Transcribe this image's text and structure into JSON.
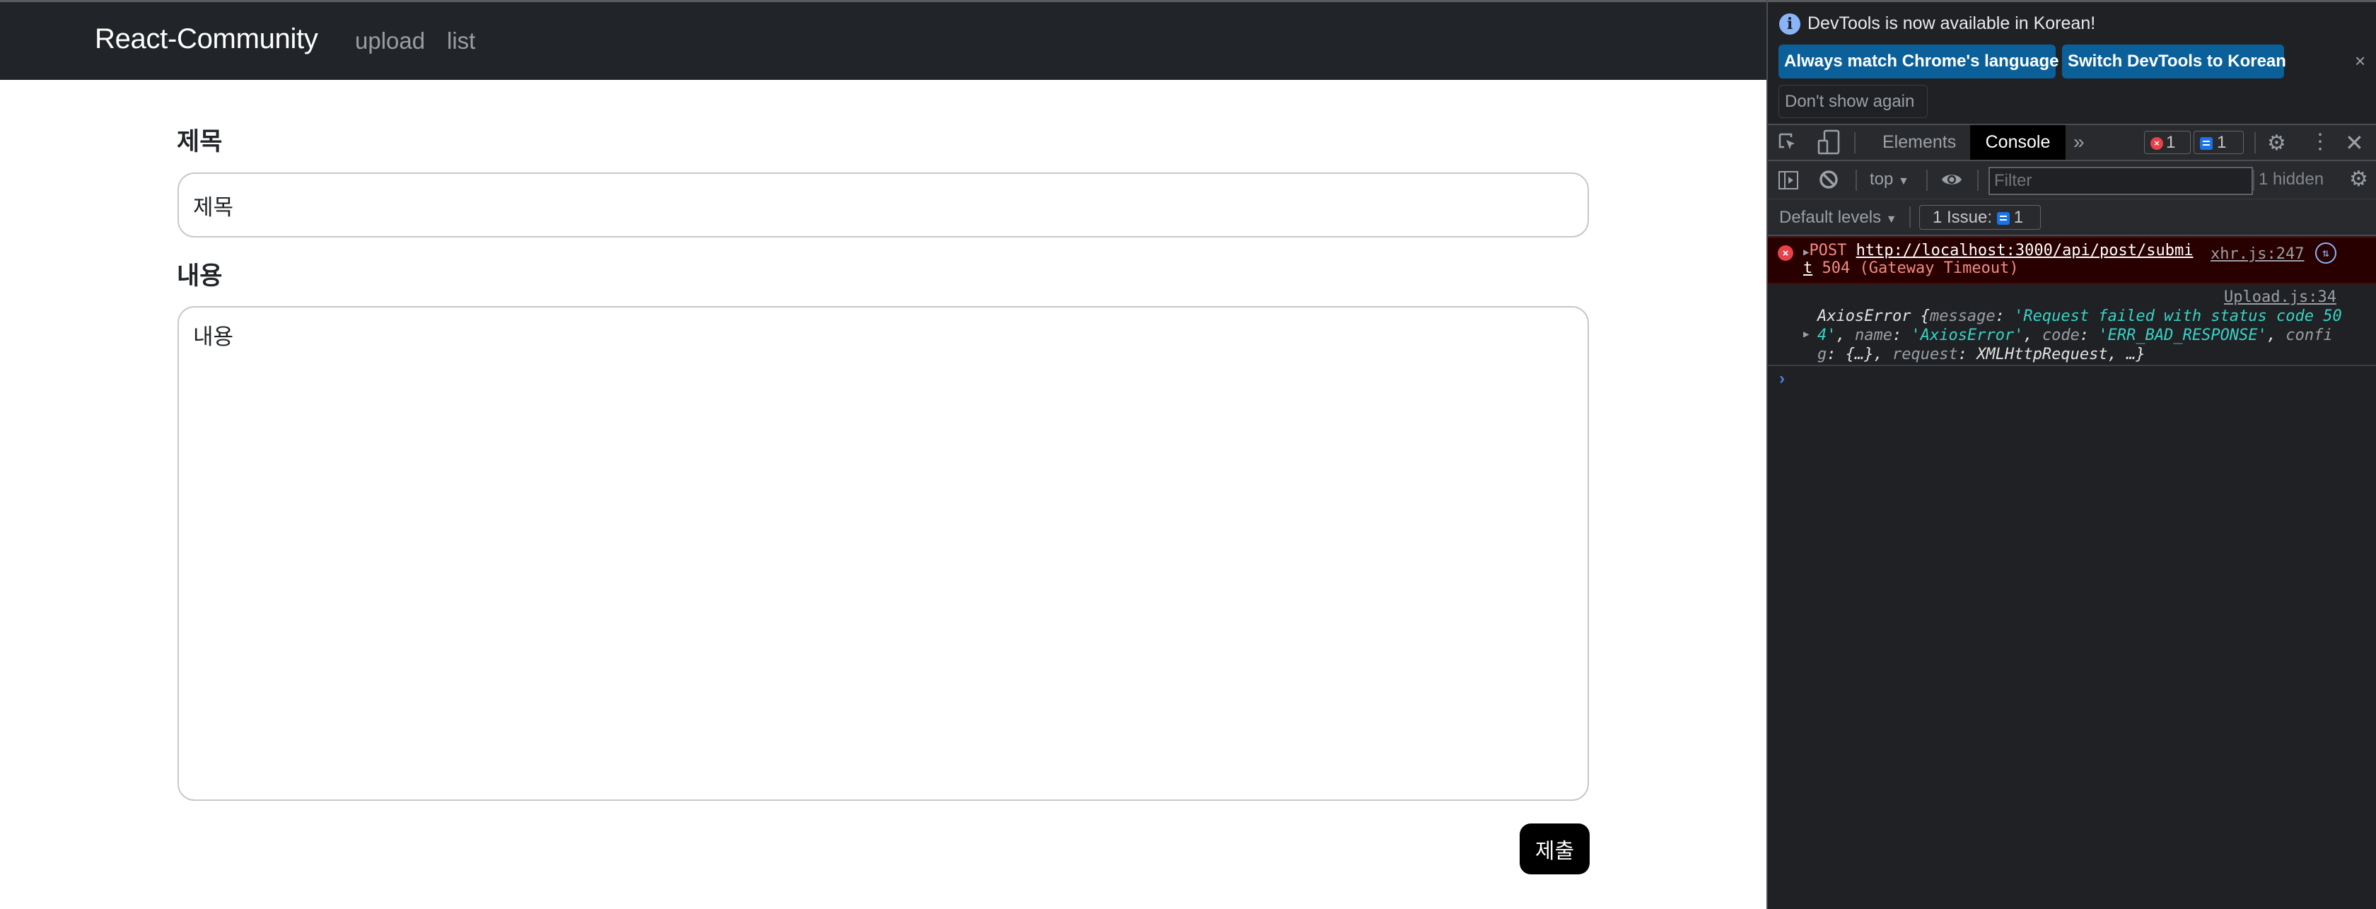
{
  "navbar": {
    "brand": "React-Community",
    "links": [
      "upload",
      "list"
    ]
  },
  "form": {
    "title_label": "제목",
    "title_value": "제목",
    "content_label": "내용",
    "content_value": "내용",
    "submit_label": "제출"
  },
  "devtools": {
    "banner": {
      "icon": "info-icon",
      "message": "DevTools is now available in Korean!",
      "primary_button": "Always match Chrome's language",
      "secondary_button": "Switch DevTools to Korean",
      "dismiss_button": "Don't show again",
      "close_glyph": "×"
    },
    "tabs": [
      {
        "label": "Elements",
        "active": false
      },
      {
        "label": "Console",
        "active": true
      }
    ],
    "more_tabs_glyph": "»",
    "error_count": "1",
    "message_count": "1",
    "toolbar": {
      "context": "top",
      "filter_placeholder": "Filter",
      "hidden_count": "1 hidden"
    },
    "levels": {
      "label": "Default levels",
      "issues_label": "1 Issue:",
      "issues_count": "1"
    },
    "console": {
      "error": {
        "method": "POST",
        "url_part1": "http://localhost:3000/api/post/submi",
        "url_part2": "t",
        "status": "504 (Gateway Timeout)",
        "source": "xhr.js:247"
      },
      "log": {
        "source": "Upload.js:34",
        "object_name": "AxiosError",
        "message_key": "message",
        "message_value_part1": "'Request failed with status code 50",
        "message_value_part2": "4'",
        "name_key": "name",
        "name_value": "'AxiosError'",
        "code_key": "code",
        "code_value": "'ERR_BAD_RESPONSE'",
        "config_key_part1": "confi",
        "config_key_part2": "g",
        "config_value": "{…}",
        "request_key": "request",
        "request_value": "XMLHttpRequest",
        "ellipsis": "…}"
      },
      "prompt_glyph": "›"
    },
    "colors": {
      "accent_button": "#0b609a",
      "error_bg": "#290000",
      "error_text": "#f28b82",
      "string_value": "#35d4c7"
    }
  }
}
